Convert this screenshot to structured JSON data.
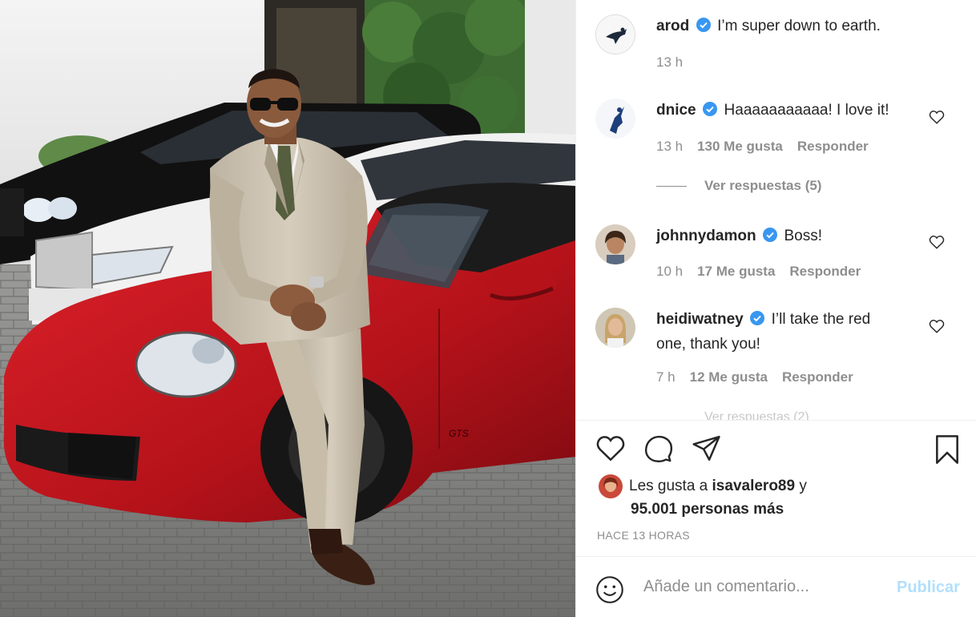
{
  "post": {
    "image": "man-in-beige-suit-sitting-on-red-sports-car",
    "car_badge": "GTS"
  },
  "caption": {
    "username": "arod",
    "verified": true,
    "text": "I’m super down to earth.",
    "time": "13 h"
  },
  "comments": [
    {
      "username": "dnice",
      "verified": true,
      "text": "Haaaaaaaaaaa! I love it!",
      "time": "13 h",
      "likes": "130 Me gusta",
      "reply_label": "Responder"
    },
    {
      "username": "johnnydamon",
      "verified": true,
      "text": "Boss!",
      "time": "10 h",
      "likes": "17 Me gusta",
      "reply_label": "Responder"
    },
    {
      "username": "heidiwatney",
      "verified": true,
      "text": "I’ll take the red one, thank you!",
      "time": "7 h",
      "likes": "12 Me gusta",
      "reply_label": "Responder"
    }
  ],
  "view_replies_label": "Ver respuestas (5)",
  "faded_replies_label": "Ver respuestas (2)",
  "likes_summary": {
    "prefix": "Les gusta a",
    "user": "isavalero89",
    "conj": "y",
    "others": "95.001 personas más"
  },
  "posted_time": "HACE 13 HORAS",
  "add_comment": {
    "placeholder": "Añade un comentario...",
    "publish_label": "Publicar"
  },
  "colors": {
    "verified_blue": "#3897f0",
    "publish_disabled": "#b2dffc",
    "muted_text": "#8e8e8e",
    "car_red": "#c8141c"
  }
}
